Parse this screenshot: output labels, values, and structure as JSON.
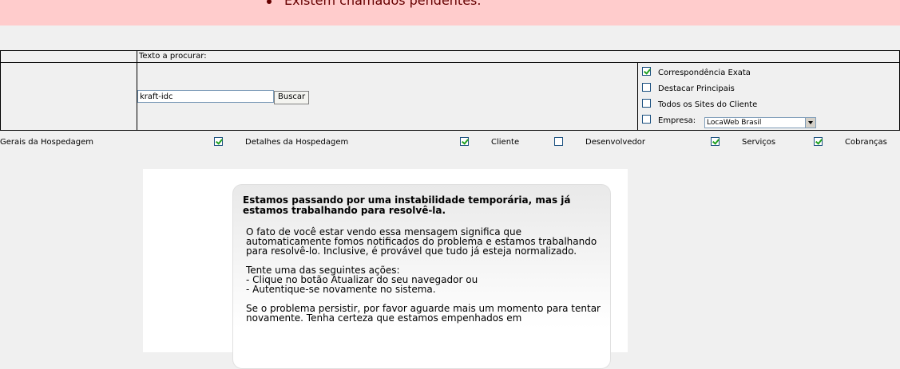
{
  "alert": {
    "message": "Existem chamados pendentes."
  },
  "search": {
    "label": "Texto a procurar:",
    "value": "kraft-idc",
    "button": "Buscar",
    "options": [
      {
        "label": "Correspondência Exata",
        "checked": true
      },
      {
        "label": "Destacar Principais",
        "checked": false
      },
      {
        "label": "Todos os Sites do Cliente",
        "checked": false
      },
      {
        "label": "Empresa:",
        "checked": false
      }
    ],
    "company_select": "LocaWeb Brasil"
  },
  "categories": [
    {
      "label": "Gerais da Hospedagem",
      "checked": true
    },
    {
      "label": "Detalhes da Hospedagem",
      "checked": true
    },
    {
      "label": "Cliente",
      "checked": false
    },
    {
      "label": "Desenvolvedor",
      "checked": true
    },
    {
      "label": "Serviços",
      "checked": true
    },
    {
      "label": "Cobranças",
      "checked": null
    }
  ],
  "error_message": {
    "title": "Estamos passando por uma instabilidade temporária, mas já estamos trabalhando para resolvê-la.",
    "paragraph1": "O fato de você estar vendo essa mensagem significa que automaticamente fomos notificados do problema e estamos trabalhando para resolvê-lo. Inclusive, é provável que tudo já esteja normalizado.",
    "actions_intro": "Tente uma das seguintes ações:",
    "action1": "- Clique no botão Atualizar do seu navegador ou",
    "action2": "- Autentique-se novamente no sistema.",
    "paragraph3": "Se o problema persistir, por favor aguarde mais um momento para tentar novamente. Tenha certeza que estamos empenhados em"
  }
}
